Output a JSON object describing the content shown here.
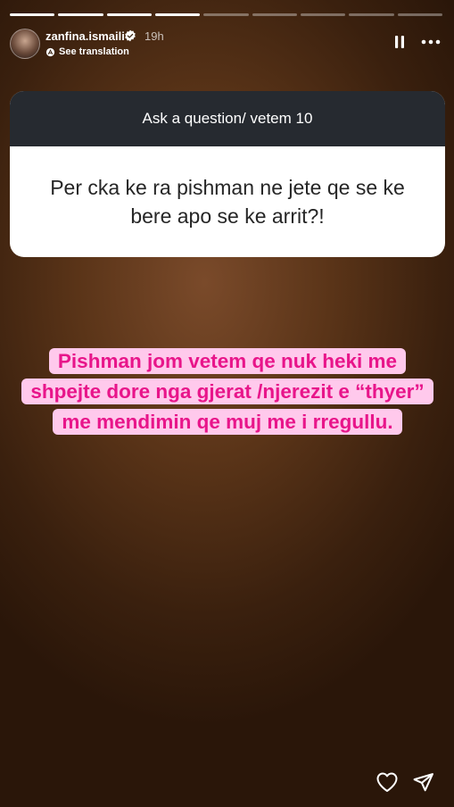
{
  "story": {
    "segments_total": 9,
    "segments_completed": 4
  },
  "header": {
    "username": "zanfina.ismaili",
    "time_ago": "19h",
    "see_translation": "See translation",
    "verified": true
  },
  "question_card": {
    "title": "Ask a question/ vetem 10",
    "question": "Per cka ke ra pishman ne jete qe se ke bere apo se ke arrit?!"
  },
  "answer": {
    "text": "Pishman jom vetem qe nuk heki me shpejte dore nga gjerat /njerezit e “thyer” me mendimin qe muj me i rregullu."
  },
  "colors": {
    "answer_text": "#e8158a",
    "answer_highlight": "#ffc9ec",
    "card_header": "#262a30"
  },
  "icons": {
    "pause": "pause-icon",
    "more": "more-icon",
    "like": "heart-icon",
    "share": "send-icon",
    "verified": "verified-badge-icon",
    "translate": "translate-icon"
  }
}
